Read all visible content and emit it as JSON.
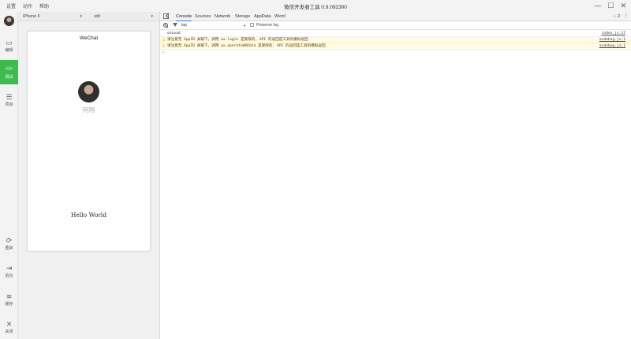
{
  "window": {
    "title": "微信开发者工具 0.9.092300",
    "menu": [
      "设置",
      "动作",
      "帮助"
    ],
    "controls": [
      "—",
      "☐",
      "✕"
    ]
  },
  "sidebar": {
    "items": [
      {
        "label": "编辑",
        "icon": "editor-icon",
        "glyph": "▭",
        "active": false
      },
      {
        "label": "调试",
        "icon": "code-icon",
        "glyph": "</>",
        "active": true
      },
      {
        "label": "项目",
        "icon": "list-icon",
        "glyph": "☰",
        "active": false
      }
    ],
    "bottom_items": [
      {
        "label": "重启",
        "icon": "restart-icon",
        "glyph": "⟳"
      },
      {
        "label": "后台",
        "icon": "background-icon",
        "glyph": "⇥"
      },
      {
        "label": "缓存",
        "icon": "cache-icon",
        "glyph": "≋"
      },
      {
        "label": "关闭",
        "icon": "close-icon",
        "glyph": "✕"
      }
    ]
  },
  "simulator": {
    "device": "iPhone 6",
    "network": "wifi",
    "nav_title": "WeChat",
    "user_name": "阿翔",
    "hello_text": "Hello World"
  },
  "devtools": {
    "tabs": [
      "Console",
      "Sources",
      "Network",
      "Storage",
      "AppData",
      "Wxml"
    ],
    "active_tab": "Console",
    "warning_count": "2",
    "context": "top",
    "preserve_log_label": "Preserve log",
    "logs": [
      {
        "level": "info",
        "text": "onLoad",
        "source": "index.js:17"
      },
      {
        "level": "warn",
        "text": "请注意无 AppID 关联下，调用 wx.login 是受限的, API 的返回是工具的模拟返回",
        "source": "asdebug.js:1"
      },
      {
        "level": "warn",
        "text": "请注意无 AppID 关联下，调用 wx.operateWXData 是受限的, API 的返回是工具的模拟返回",
        "source": "asdebug.js:1"
      }
    ],
    "prompt": "›"
  },
  "colors": {
    "accent_green": "#3dbb4f",
    "warn_yellow": "#e7a400",
    "tab_blue": "#3879d9"
  }
}
